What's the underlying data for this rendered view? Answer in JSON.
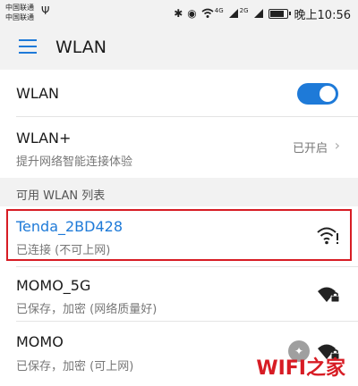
{
  "status_bar": {
    "carrier_1": "中国联通",
    "carrier_2": "中国联通",
    "net_type_1": "4G",
    "net_type_2": "2G",
    "battery_percent": 85,
    "time": "晚上10:56"
  },
  "app_bar": {
    "title": "WLAN"
  },
  "settings": {
    "wlan_label": "WLAN",
    "wlan_on": true,
    "wlan_plus_label": "WLAN+",
    "wlan_plus_desc": "提升网络智能连接体验",
    "wlan_plus_status": "已开启"
  },
  "section_header": "可用 WLAN 列表",
  "networks": [
    {
      "ssid": "Tenda_2BD428",
      "status": "已连接 (不可上网)",
      "icon": "wifi-warning-icon",
      "connected": true
    },
    {
      "ssid": "MOMO_5G",
      "status": "已保存，加密 (网络质量好)",
      "icon": "wifi-lock-icon",
      "connected": false
    },
    {
      "ssid": "MOMO",
      "status": "已保存，加密 (可上网)",
      "icon": "wifi-lock-icon",
      "connected": false
    }
  ],
  "watermark": "WIFI之家",
  "colors": {
    "accent": "#1e7ad8",
    "highlight": "#d71c24"
  }
}
